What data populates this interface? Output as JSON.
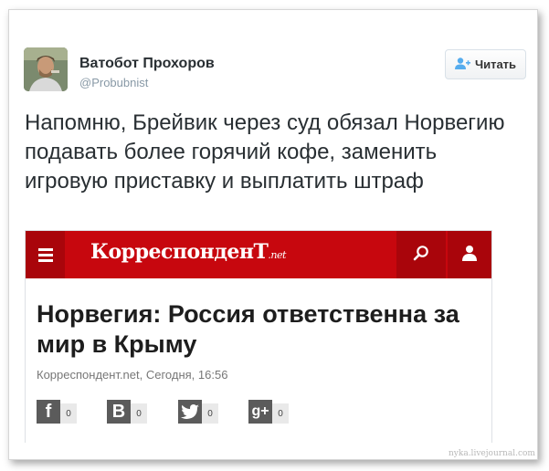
{
  "tweet": {
    "author_name": "Ватобот Прохоров",
    "author_handle": "@Probubnist",
    "follow_label": "Читать",
    "text": "Напомню, Брейвик через суд обязал Норвегию подавать более горячий кофе, заменить игровую приставку и выплатить штраф"
  },
  "embed": {
    "site_name": "КорреспонденТ",
    "site_tld": ".net",
    "headline": "Норвегия: Россия ответственна за мир в Крыму",
    "meta": "Корреспондент.net, Сегодня, 16:56",
    "share": [
      {
        "icon": "facebook-icon",
        "glyph": "f",
        "count": "0"
      },
      {
        "icon": "vkontakte-icon",
        "glyph": "B",
        "count": "0"
      },
      {
        "icon": "twitter-icon",
        "glyph": "",
        "count": "0"
      },
      {
        "icon": "google-plus-icon",
        "glyph": "g+",
        "count": "0"
      }
    ]
  },
  "watermark": "nyka.livejournal.com",
  "colors": {
    "brand_red": "#c7070e",
    "brand_red_dark": "#a9050b",
    "follow_icon": "#55acee",
    "share_grey": "#5b5b5b"
  }
}
